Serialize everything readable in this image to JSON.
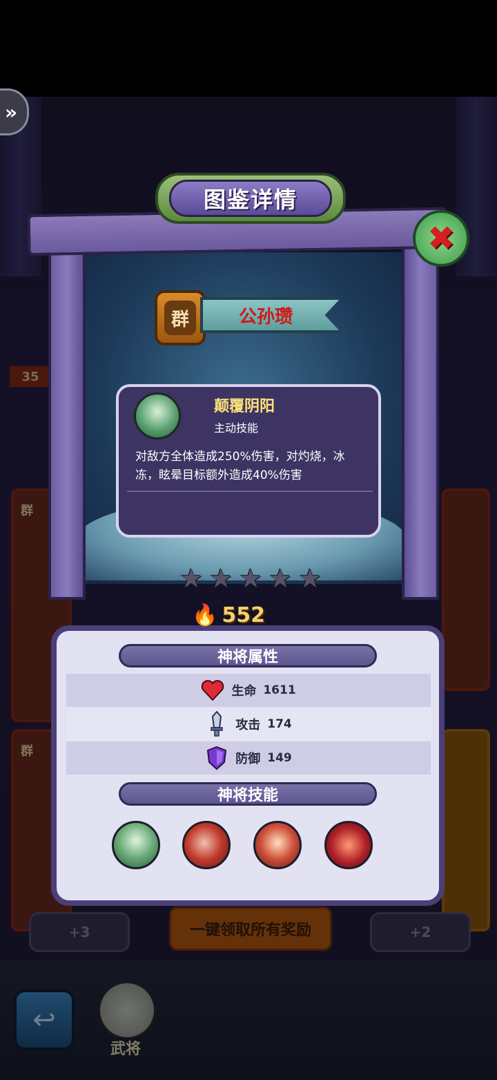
{
  "window": {
    "title": "图鉴详情"
  },
  "hero": {
    "faction": "群",
    "name": "公孙瓒"
  },
  "skill_tooltip": {
    "name": "颠覆阴阳",
    "type": "主动技能",
    "description": "对敌方全体造成250%伤害，对灼烧，冰冻，眩晕目标额外造成40%伤害"
  },
  "stars": {
    "filled": 0,
    "total": 5
  },
  "power": {
    "value": "552"
  },
  "attributes": {
    "header": "神将属性",
    "items": [
      {
        "label": "生命",
        "value": "1611",
        "icon": "heart-icon"
      },
      {
        "label": "攻击",
        "value": "174",
        "icon": "sword-icon"
      },
      {
        "label": "防御",
        "value": "149",
        "icon": "shield-icon"
      }
    ]
  },
  "skills": {
    "header": "神将技能",
    "items": [
      {
        "icon": "skill-1-icon"
      },
      {
        "icon": "skill-2-icon"
      },
      {
        "icon": "skill-3-icon"
      },
      {
        "icon": "skill-4-icon"
      }
    ]
  },
  "background": {
    "claim_all_label": "一键领取所有奖励",
    "left_bonus": "+3",
    "right_bonus": "+2",
    "left_level": "35",
    "card_faction_1": "群",
    "card_faction_2": "群"
  },
  "nav": {
    "hero_label": "武将"
  },
  "colors": {
    "accent_gold": "#f6d06a",
    "name_red": "#d01818",
    "panel_purple": "#4a3f78"
  }
}
